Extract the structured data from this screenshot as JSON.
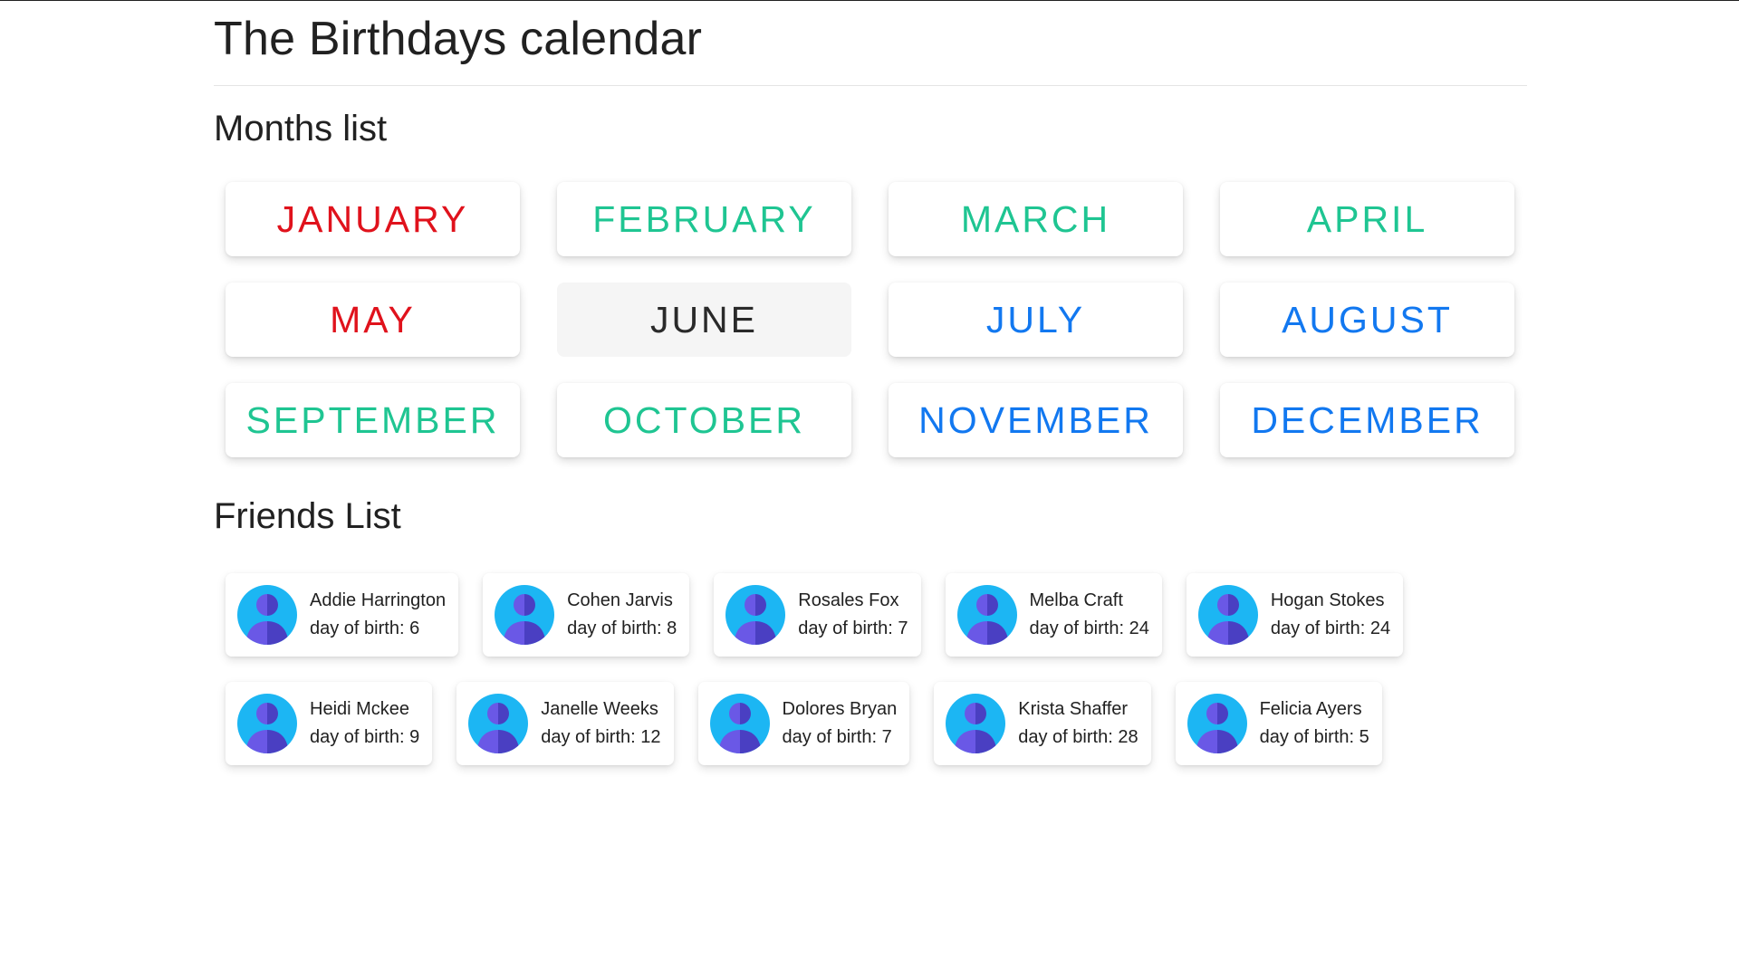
{
  "page_title": "The Birthdays calendar",
  "months_section": {
    "title": "Months list",
    "months": [
      {
        "label": "JANUARY",
        "color": "#e0121c",
        "active": false
      },
      {
        "label": "FEBRUARY",
        "color": "#1fc592",
        "active": false
      },
      {
        "label": "MARCH",
        "color": "#1fc592",
        "active": false
      },
      {
        "label": "APRIL",
        "color": "#1fc592",
        "active": false
      },
      {
        "label": "MAY",
        "color": "#e0121c",
        "active": false
      },
      {
        "label": "JUNE",
        "color": "#2a2a2a",
        "active": true
      },
      {
        "label": "JULY",
        "color": "#1278f0",
        "active": false
      },
      {
        "label": "AUGUST",
        "color": "#1278f0",
        "active": false
      },
      {
        "label": "SEPTEMBER",
        "color": "#1fc592",
        "active": false
      },
      {
        "label": "OCTOBER",
        "color": "#1fc592",
        "active": false
      },
      {
        "label": "NOVEMBER",
        "color": "#1278f0",
        "active": false
      },
      {
        "label": "DECEMBER",
        "color": "#1278f0",
        "active": false
      }
    ]
  },
  "friends_section": {
    "title": "Friends List",
    "dob_label": "day of birth:",
    "friends": [
      {
        "name": "Addie Harrington",
        "day": "6"
      },
      {
        "name": "Cohen Jarvis",
        "day": "8"
      },
      {
        "name": "Rosales Fox",
        "day": "7"
      },
      {
        "name": "Melba Craft",
        "day": "24"
      },
      {
        "name": "Hogan Stokes",
        "day": "24"
      },
      {
        "name": "Heidi Mckee",
        "day": "9"
      },
      {
        "name": "Janelle Weeks",
        "day": "12"
      },
      {
        "name": "Dolores Bryan",
        "day": "7"
      },
      {
        "name": "Krista Shaffer",
        "day": "28"
      },
      {
        "name": "Felicia Ayers",
        "day": "5"
      }
    ]
  },
  "avatar_icon": "user-avatar-icon",
  "colors": {
    "avatar_bg": "#1cb6f3",
    "avatar_figure_dark": "#4a3fc2",
    "avatar_figure_light": "#6a58e6"
  }
}
